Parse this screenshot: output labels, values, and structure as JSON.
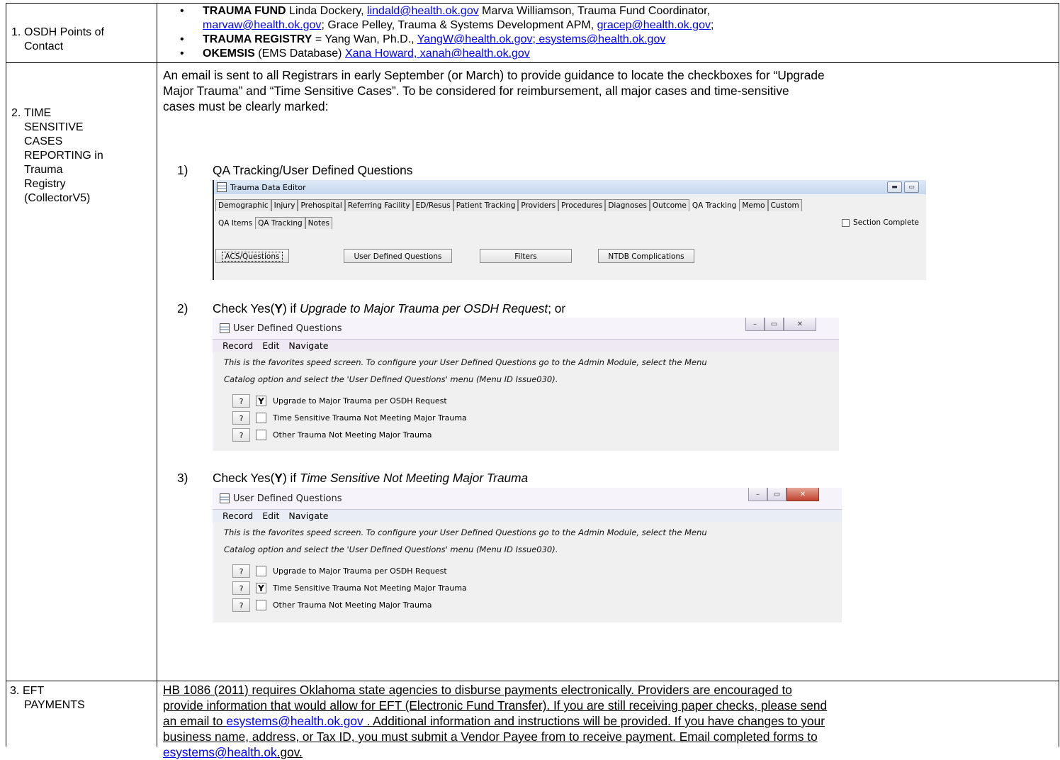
{
  "row1": {
    "num": "1.",
    "label_line1": "OSDH Points of",
    "label_line2": "Contact",
    "bullet1": {
      "bold": "TRAUMA FUND",
      "t1": " Linda Dockery, ",
      "link1": "lindald@health.ok.gov",
      "t2": " Marva Williamson, Trauma Fund Coordinator,",
      "link2": "marvaw@health.ok.gov",
      "t3": "; Grace Pelley, Trauma & Systems Development APM, ",
      "link3": "gracep@health.ok.gov",
      "t4": ";"
    },
    "bullet2": {
      "bold": "TRAUMA REGISTRY",
      "t1": " = Yang Wan, Ph.D., ",
      "link1": "YangW@health.ok.gov; esystems@health.ok.gov"
    },
    "bullet3": {
      "bold": "OKEMSIS",
      "t1": " (EMS Database) ",
      "link1": " Xana Howard, xanah@health.ok.gov"
    }
  },
  "row2": {
    "num": "2.",
    "label_lines": [
      "TIME",
      "SENSITIVE",
      "CASES",
      "REPORTING in",
      "Trauma",
      "Registry",
      "(CollectorV5)"
    ],
    "para_lines": [
      "An email is sent to all Registrars in early September (or March) to provide guidance to locate the checkboxes for “Upgrade",
      "Major Trauma” and “Time Sensitive Cases”.  To be considered for reimbursement, all major cases and time-sensitive",
      "cases must be clearly marked:"
    ],
    "step1": {
      "num": "1)",
      "text": "QA Tracking/User Defined Questions"
    },
    "step2": {
      "num": "2)",
      "pre": "Check Yes(",
      "bold": "Y",
      "mid": ") if ",
      "ital": "Upgrade to Major Trauma per OSDH Request",
      "post": "; or"
    },
    "step3": {
      "num": "3)",
      "pre": "Check Yes(",
      "bold": "Y",
      "mid": ") if ",
      "ital": "Time Sensitive Not Meeting Major Trauma"
    }
  },
  "editor": {
    "title": "Trauma Data Editor",
    "tabs": [
      "Demographic",
      "Injury",
      "Prehospital",
      "Referring Facility",
      "ED/Resus",
      "Patient Tracking",
      "Providers",
      "Procedures",
      "Diagnoses",
      "Outcome",
      "QA Tracking",
      "Memo",
      "Custom"
    ],
    "subtabs": [
      "QA Items",
      "QA Tracking",
      "Notes"
    ],
    "section_complete": "Section Complete",
    "buttons": [
      "ACS/Questions",
      "User Defined Questions",
      "Filters",
      "NTDB Complications"
    ]
  },
  "udq": {
    "title": "User Defined Questions",
    "menu": [
      "Record",
      "Edit",
      "Navigate"
    ],
    "note1": "This is the favorites speed screen.  To configure your User Defined Questions go to the Admin Module, select the Menu",
    "note2": "Catalog option and select the 'User Defined Questions' menu (Menu ID Issue030).",
    "help": "?",
    "questions": [
      "Upgrade to Major Trauma per OSDH Request",
      "Time Sensitive Trauma Not Meeting Major Trauma",
      "Other Trauma Not Meeting Major Trauma"
    ],
    "check_mark": "Y",
    "win2_checks": [
      "Y",
      "",
      ""
    ],
    "win3_checks": [
      "",
      "Y",
      ""
    ]
  },
  "row3": {
    "num": "3.",
    "label_line1": "EFT",
    "label_line2": "PAYMENTS",
    "lines": [
      "HB 1086 (2011) requires Oklahoma state agencies to disburse payments electronically. Providers are encouraged to",
      "provide information that would allow for EFT (Electronic Fund Transfer). If you are still receiving paper checks, please send",
      "an email to ",
      "esystems@health.ok.gov",
      " . Additional information and instructions will be provided. If you have changes to your",
      "business name, address, or Tax ID, you must submit a Vendor Payee from to receive payment. Email completed forms to",
      "esystems@health.ok",
      ".gov."
    ]
  }
}
